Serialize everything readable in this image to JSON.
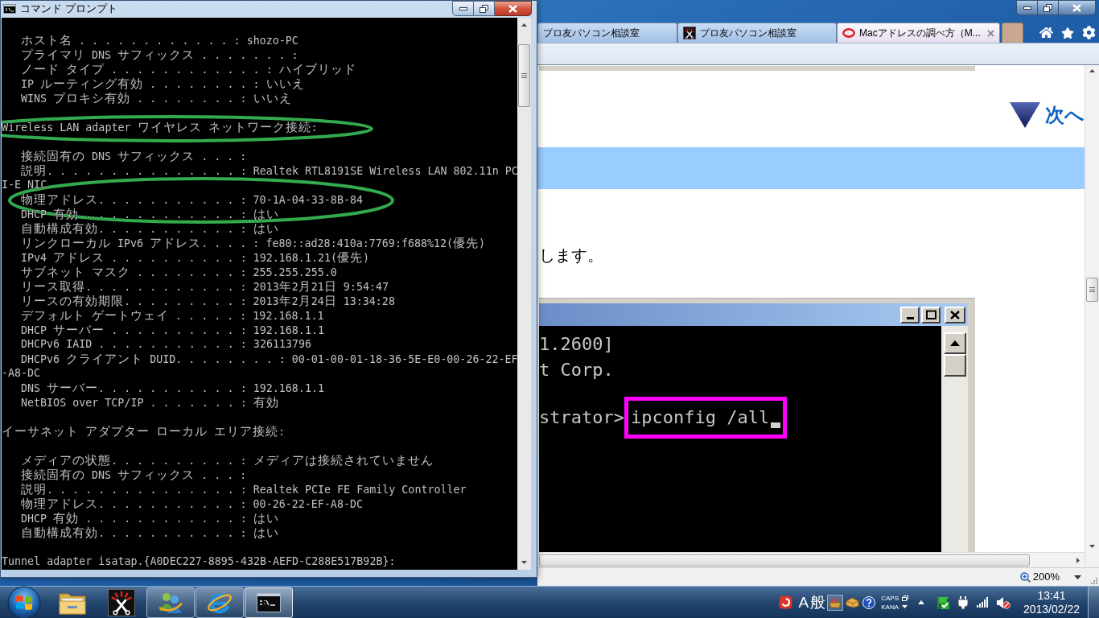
{
  "console_window": {
    "title": "コマンド プロンプト",
    "active": true,
    "sections": [
      {
        "entries": [
          {
            "kind": "field",
            "text": "ホスト名 . . . . . . . . . . . . : shozo-PC"
          },
          {
            "kind": "field",
            "text": "プライマリ DNS サフィックス . . . . . . . :"
          },
          {
            "kind": "field",
            "text": "ノード タイプ . . . . . . . . . . . . : ハイブリッド"
          },
          {
            "kind": "field",
            "text": "IP ルーティング有効 . . . . . . . . : いいえ"
          },
          {
            "kind": "field",
            "text": "WINS プロキシ有効 . . . . . . . . : いいえ"
          }
        ]
      },
      {
        "heading": "Wireless LAN adapter ワイヤレス ネットワーク接続:",
        "entries": [
          {
            "kind": "field",
            "text": "接続固有の DNS サフィックス . . . :"
          },
          {
            "kind": "field",
            "text": "説明. . . . . . . . . . . . . . . : Realtek RTL8191SE Wireless LAN 802.11n PC"
          },
          {
            "kind": "wrap",
            "text": "I-E NIC"
          },
          {
            "kind": "field",
            "text": "物理アドレス. . . . . . . . . . . : 70-1A-04-33-8B-84"
          },
          {
            "kind": "field",
            "text": "DHCP 有効 . . . . . . . . . . . . : はい"
          },
          {
            "kind": "field",
            "text": "自動構成有効. . . . . . . . . . . : はい"
          },
          {
            "kind": "field",
            "text": "リンクローカル IPv6 アドレス. . . . : fe80::ad28:410a:7769:f688%12(優先)"
          },
          {
            "kind": "field",
            "text": "IPv4 アドレス . . . . . . . . . . : 192.168.1.21(優先)"
          },
          {
            "kind": "field",
            "text": "サブネット マスク . . . . . . . . : 255.255.255.0"
          },
          {
            "kind": "field",
            "text": "リース取得. . . . . . . . . . . . : 2013年2月21日 9:54:47"
          },
          {
            "kind": "field",
            "text": "リースの有効期限. . . . . . . . . : 2013年2月24日 13:34:28"
          },
          {
            "kind": "field",
            "text": "デフォルト ゲートウェイ . . . . . : 192.168.1.1"
          },
          {
            "kind": "field",
            "text": "DHCP サーバー . . . . . . . . . . : 192.168.1.1"
          },
          {
            "kind": "field",
            "text": "DHCPv6 IAID . . . . . . . . . . . : 326113796"
          },
          {
            "kind": "field",
            "text": "DHCPv6 クライアント DUID. . . . . . . . : 00-01-00-01-18-36-5E-E0-00-26-22-EF"
          },
          {
            "kind": "wrap",
            "text": "-A8-DC"
          },
          {
            "kind": "field",
            "text": "DNS サーバー. . . . . . . . . . . : 192.168.1.1"
          },
          {
            "kind": "field",
            "text": "NetBIOS over TCP/IP . . . . . . . : 有効"
          }
        ]
      },
      {
        "heading": "イーサネット アダプター ローカル エリア接続:",
        "entries": [
          {
            "kind": "field",
            "text": "メディアの状態. . . . . . . . . . : メディアは接続されていません"
          },
          {
            "kind": "field",
            "text": "接続固有の DNS サフィックス . . . :"
          },
          {
            "kind": "field",
            "text": "説明. . . . . . . . . . . . . . . : Realtek PCIe FE Family Controller"
          },
          {
            "kind": "field",
            "text": "物理アドレス. . . . . . . . . . . : 00-26-22-EF-A8-DC"
          },
          {
            "kind": "field",
            "text": "DHCP 有効 . . . . . . . . . . . . : はい"
          },
          {
            "kind": "field",
            "text": "自動構成有効. . . . . . . . . . . : はい"
          }
        ]
      },
      {
        "heading": "Tunnel adapter isatap.{A0DEC227-8895-432B-AEFD-C288E517B92B}:"
      }
    ]
  },
  "browser": {
    "active": false,
    "tabs": [
      {
        "title": "プロ友パソコン相談室",
        "selected": false
      },
      {
        "title": "プロ友パソコン相談室",
        "selected": false
      },
      {
        "title": "Macアドレスの調べ方（M...",
        "selected": true
      }
    ],
    "page": {
      "next_link": "次へ",
      "text": "します。",
      "screenshot": {
        "lines": [
          "1.2600]",
          "t Corp."
        ],
        "prompt": "strator>",
        "command": "ipconfig /all"
      }
    },
    "status_bar": {
      "zoom": "200%"
    }
  },
  "taskbar": {
    "apps": [
      {
        "running": false,
        "selected": false
      },
      {
        "running": false,
        "selected": false
      },
      {
        "running": true,
        "selected": false
      },
      {
        "running": true,
        "selected": false
      },
      {
        "running": true,
        "selected": true
      }
    ],
    "tray": {
      "input_mode": "A",
      "conversion_mode": "般",
      "caps": "CAPS",
      "kana": "KANA"
    },
    "clock": {
      "time": "13:41",
      "date": "2013/02/22"
    }
  }
}
